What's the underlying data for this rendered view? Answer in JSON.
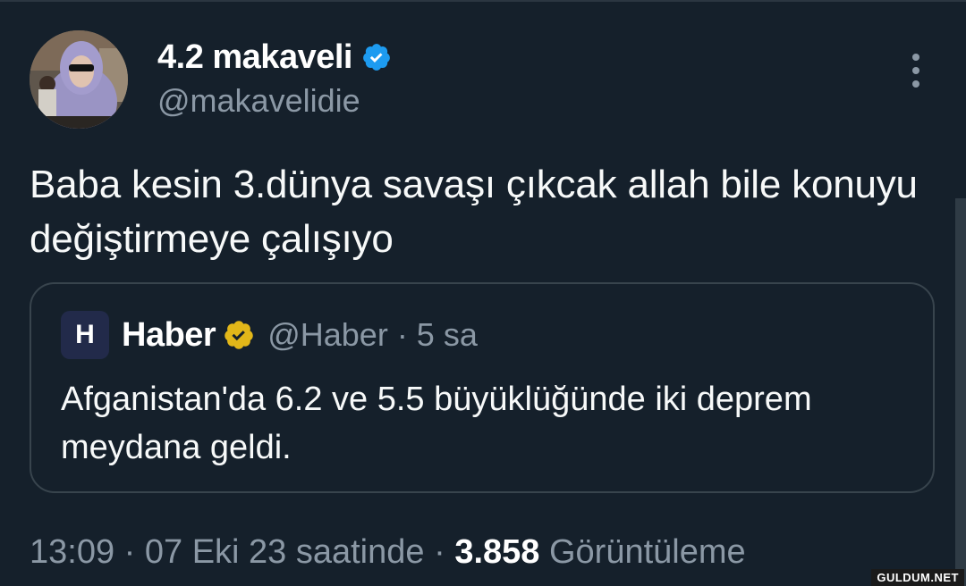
{
  "tweet": {
    "author_name": "4.2 makaveli",
    "author_handle": "@makavelidie",
    "text": "Baba kesin 3.dünya savaşı çıkcak allah bile konuyu değiştirmeye çalışıyo",
    "timestamp": "13:09 · 07 Eki 23 saatinde",
    "separator": " · ",
    "views_count": "3.858",
    "views_label": "Görüntüleme"
  },
  "quoted": {
    "logo_letter": "H",
    "name": "Haber",
    "handle_time": "@Haber · 5 sa",
    "text": "Afganistan'da 6.2 ve 5.5 büyüklüğünde iki deprem meydana geldi."
  },
  "icons": {
    "verified_blue": "verified-badge-blue",
    "verified_gold": "verified-badge-gold",
    "more": "more-options-icon"
  },
  "colors": {
    "background": "#15202b",
    "verified_blue": "#1d9bf0",
    "verified_gold": "#e2b719",
    "secondary_text": "#8b98a5"
  },
  "watermark": "GULDUM.NET"
}
